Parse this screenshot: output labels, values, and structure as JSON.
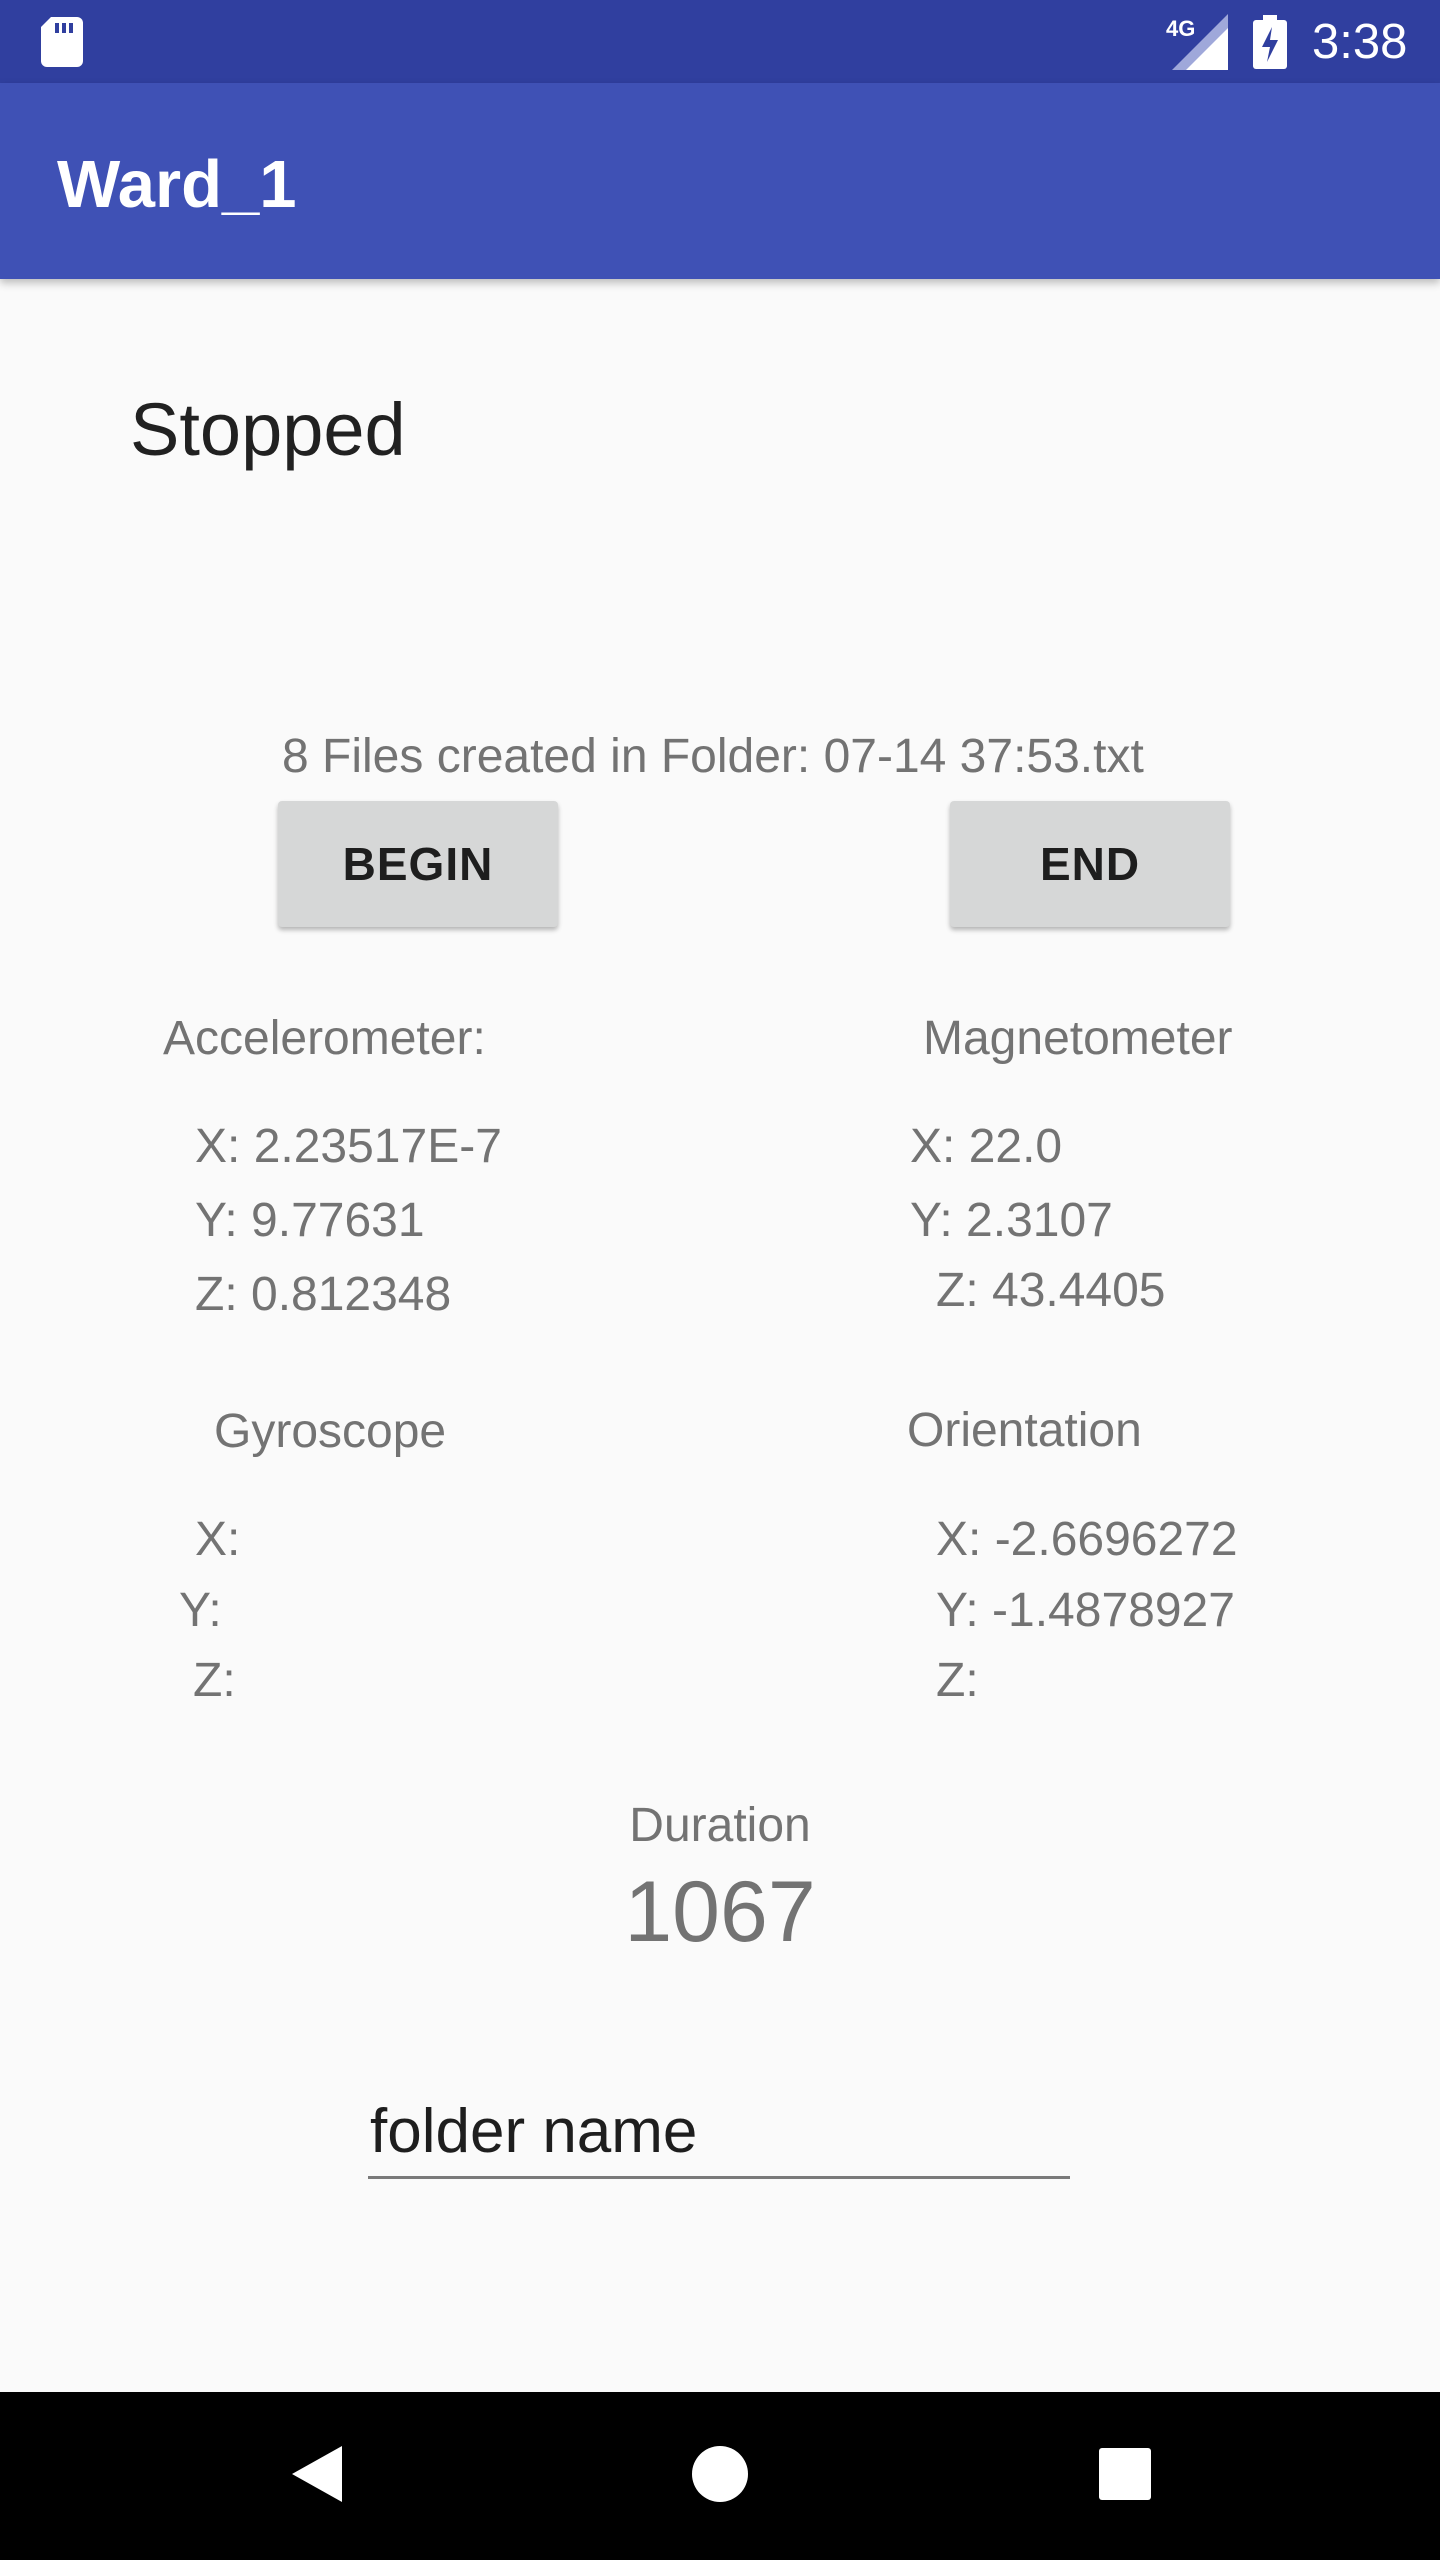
{
  "status_bar": {
    "network_type": "4G",
    "time": "3:38"
  },
  "app_bar": {
    "title": "Ward_1"
  },
  "main": {
    "status": "Stopped",
    "files_info": "8 Files created in Folder: 07-14 37:53.txt",
    "buttons": {
      "begin": "BEGIN",
      "end": "END"
    },
    "sensors": {
      "accelerometer": {
        "title": "Accelerometer:",
        "x": "X: 2.23517E-7",
        "y": "Y: 9.77631",
        "z": "Z: 0.812348"
      },
      "magnetometer": {
        "title": "Magnetometer",
        "x": "X: 22.0",
        "y": "Y: 2.3107",
        "z": "Z: 43.4405"
      },
      "gyroscope": {
        "title": "Gyroscope",
        "x": "X:",
        "y": "Y:",
        "z": "Z:"
      },
      "orientation": {
        "title": "Orientation",
        "x": "X: -2.6696272",
        "y": "Y: -1.4878927",
        "z": "Z:"
      }
    },
    "duration": {
      "label": "Duration",
      "value": "1067"
    },
    "folder_input": {
      "placeholder": "folder name",
      "value": ""
    }
  },
  "colors": {
    "status_bar": "#303f9f",
    "app_bar": "#3f51b5",
    "background": "#fafafa",
    "button": "#d6d7d7",
    "secondary_text": "#737373",
    "nav_bar": "#000000"
  },
  "icons": {
    "status_left": "sd-card-icon",
    "status_signal": "signal-icon",
    "status_battery": "battery-charging-icon",
    "nav_back": "back-icon",
    "nav_home": "home-icon",
    "nav_recents": "recents-icon"
  }
}
